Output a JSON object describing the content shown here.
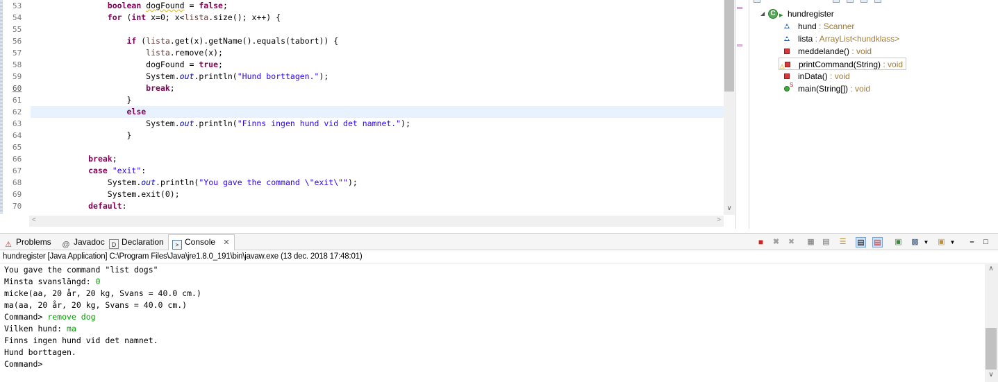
{
  "editor": {
    "lines": [
      {
        "n": "53",
        "tokens": [
          {
            "t": "                "
          },
          {
            "t": "boolean",
            "c": "kw"
          },
          {
            "t": " "
          },
          {
            "t": "dogFound",
            "c": "sq"
          },
          {
            "t": " = "
          },
          {
            "t": "false",
            "c": "kw"
          },
          {
            "t": ";"
          }
        ]
      },
      {
        "n": "54",
        "tokens": [
          {
            "t": "                "
          },
          {
            "t": "for",
            "c": "kw"
          },
          {
            "t": " ("
          },
          {
            "t": "int",
            "c": "kw"
          },
          {
            "t": " x=0; x<"
          },
          {
            "t": "lista",
            "c": "var"
          },
          {
            "t": ".size(); x++) {"
          }
        ]
      },
      {
        "n": "55",
        "tokens": [
          {
            "t": ""
          }
        ]
      },
      {
        "n": "56",
        "tokens": [
          {
            "t": "                    "
          },
          {
            "t": "if",
            "c": "kw"
          },
          {
            "t": " ("
          },
          {
            "t": "lista",
            "c": "var"
          },
          {
            "t": ".get(x).getName().equals(tabort)) {"
          }
        ]
      },
      {
        "n": "57",
        "tokens": [
          {
            "t": "                        "
          },
          {
            "t": "lista",
            "c": "var"
          },
          {
            "t": ".remove(x);"
          }
        ]
      },
      {
        "n": "58",
        "tokens": [
          {
            "t": "                        dogFound = "
          },
          {
            "t": "true",
            "c": "kw"
          },
          {
            "t": ";"
          }
        ]
      },
      {
        "n": "59",
        "tokens": [
          {
            "t": "                        System."
          },
          {
            "t": "out",
            "c": "fld"
          },
          {
            "t": ".println("
          },
          {
            "t": "\"Hund borttagen.\"",
            "c": "st"
          },
          {
            "t": ");"
          }
        ]
      },
      {
        "n": "60",
        "tokens": [
          {
            "t": "                        "
          },
          {
            "t": "break",
            "c": "kw"
          },
          {
            "t": ";"
          }
        ]
      },
      {
        "n": "61",
        "tokens": [
          {
            "t": "                    }"
          }
        ]
      },
      {
        "n": "62",
        "tokens": [
          {
            "t": "                    "
          },
          {
            "t": "else",
            "c": "kw"
          }
        ]
      },
      {
        "n": "63",
        "tokens": [
          {
            "t": "                        System."
          },
          {
            "t": "out",
            "c": "fld"
          },
          {
            "t": ".println("
          },
          {
            "t": "\"Finns ingen hund vid det namnet.\"",
            "c": "st"
          },
          {
            "t": ");"
          }
        ]
      },
      {
        "n": "64",
        "tokens": [
          {
            "t": "                    }"
          }
        ]
      },
      {
        "n": "65",
        "tokens": [
          {
            "t": ""
          }
        ]
      },
      {
        "n": "66",
        "tokens": [
          {
            "t": "            "
          },
          {
            "t": "break",
            "c": "kw"
          },
          {
            "t": ";"
          }
        ]
      },
      {
        "n": "67",
        "tokens": [
          {
            "t": "            "
          },
          {
            "t": "case",
            "c": "kw"
          },
          {
            "t": " "
          },
          {
            "t": "\"exit\"",
            "c": "st"
          },
          {
            "t": ":"
          }
        ]
      },
      {
        "n": "68",
        "tokens": [
          {
            "t": "                System."
          },
          {
            "t": "out",
            "c": "fld"
          },
          {
            "t": ".println("
          },
          {
            "t": "\"You gave the command \\\"exit\\\"\"",
            "c": "st"
          },
          {
            "t": ");"
          }
        ]
      },
      {
        "n": "69",
        "tokens": [
          {
            "t": "                System.exit(0);"
          }
        ]
      },
      {
        "n": "70",
        "tokens": [
          {
            "t": "            "
          },
          {
            "t": "default",
            "c": "kw"
          },
          {
            "t": ":"
          }
        ]
      }
    ],
    "current_line": "60",
    "highlighted_line": "62"
  },
  "outline": {
    "class_name": "hundregister",
    "members": [
      {
        "name": "hund",
        "type": " : Scanner",
        "kind": "field"
      },
      {
        "name": "lista",
        "type": " : ArrayList<hundklass>",
        "kind": "field"
      },
      {
        "name": "meddelande()",
        "type": " : void",
        "kind": "private"
      },
      {
        "name": "printCommand(String)",
        "type": " : void",
        "kind": "private-warn"
      },
      {
        "name": "inData()",
        "type": " : void",
        "kind": "private"
      },
      {
        "name": "main(String[])",
        "type": " : void",
        "kind": "public-static"
      }
    ]
  },
  "tabs": {
    "problems": "Problems",
    "javadoc": "Javadoc",
    "declaration": "Declaration",
    "console": "Console"
  },
  "console": {
    "process": "hundregister [Java Application] C:\\Program Files\\Java\\jre1.8.0_191\\bin\\javaw.exe (13 dec. 2018 17:48:01)",
    "lines": [
      {
        "text": "You gave the command \"list dogs\""
      },
      {
        "text": "Minsta svanslängd: ",
        "input": "0"
      },
      {
        "text": "micke(aa, 20 år, 20 kg, Svans = 40.0 cm.)"
      },
      {
        "text": "ma(aa, 20 år, 20 kg, Svans = 40.0 cm.)"
      },
      {
        "text": "Command> ",
        "input": "remove dog"
      },
      {
        "text": "Vilken hund: ",
        "input": "ma"
      },
      {
        "text": "Finns ingen hund vid det namnet."
      },
      {
        "text": "Hund borttagen."
      },
      {
        "text": "Command>"
      }
    ]
  },
  "colors": {
    "keyword": "#7f0055",
    "string": "#2a00ff",
    "console_input": "#00a000",
    "line_highlight": "#e8f2fe"
  }
}
